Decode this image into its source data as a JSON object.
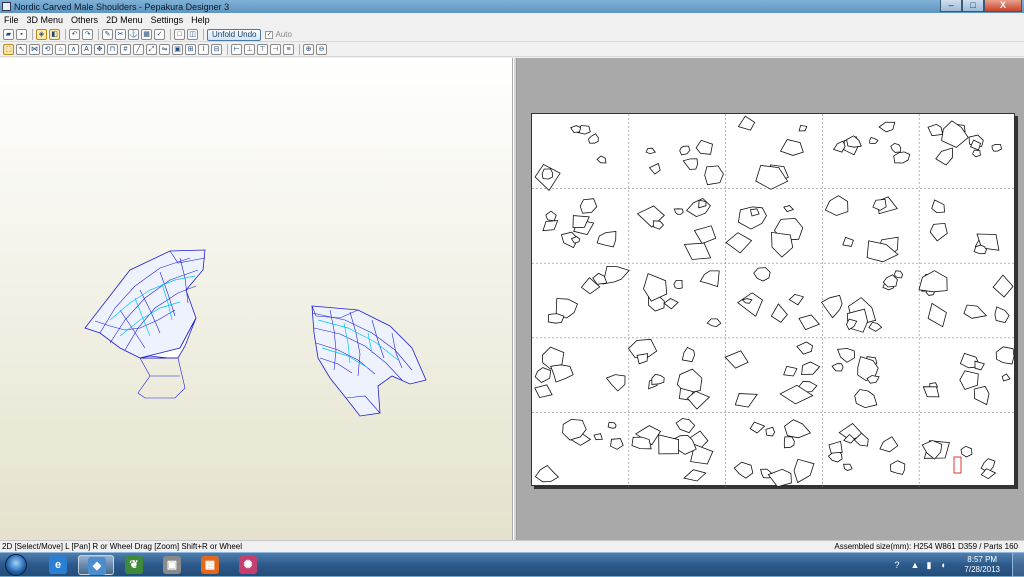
{
  "window": {
    "title": "Nordic Carved Male Shoulders - Pepakura Designer 3",
    "controls": {
      "minimize": "–",
      "maximize": "□",
      "close": "X"
    }
  },
  "menu": [
    "File",
    "3D Menu",
    "Others",
    "2D Menu",
    "Settings",
    "Help"
  ],
  "toolbar": {
    "unfold_undo_label": "Unfold Undo",
    "auto_label": "Auto"
  },
  "status": {
    "left": "2D [Select/Move] L [Pan] R or Wheel Drag [Zoom] Shift+R or Wheel",
    "right": "Assembled size(mm): H254 W861 D359 / Parts 160"
  },
  "taskbar": {
    "time": "8:57 PM",
    "date": "7/28/2013"
  }
}
